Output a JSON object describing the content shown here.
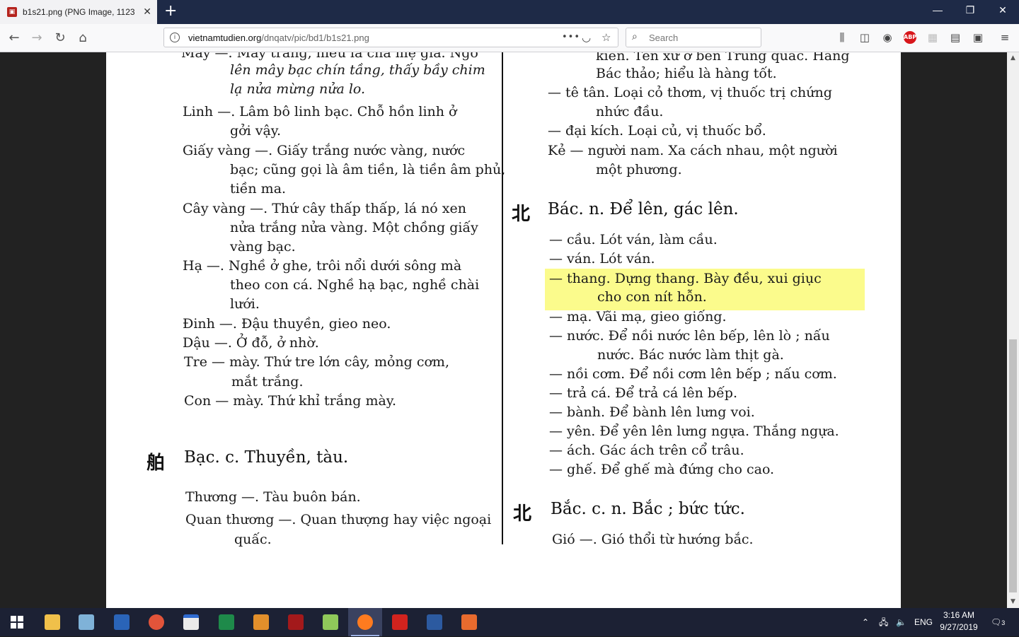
{
  "browser": {
    "tab_title": "b1s21.png (PNG Image, 1123 ×",
    "tab_close": "✕",
    "new_tab": "+",
    "window_controls": {
      "minimize": "—",
      "restore": "❐",
      "close": "✕"
    },
    "url_domain": "vietnamtudien.org",
    "url_path": "/dnqatv/pic/bd1/b1s21.png",
    "page_actions": "•••",
    "search_placeholder": "Search",
    "icons": [
      "back-icon",
      "forward-icon",
      "reload-icon",
      "home-icon",
      "info-icon",
      "pocket-icon",
      "bookmark-star-icon",
      "search-icon",
      "library-icon",
      "sidebar-icon",
      "account-icon",
      "adblock-icon",
      "extension-icon",
      "reader-icon",
      "screenshot-icon",
      "menu-icon"
    ],
    "abp_label": "ABP"
  },
  "document": {
    "left_column": {
      "top_partial_1": "Mây —. Mây trắng, hiểu là cha mẹ già. Ngó",
      "top_partial_2": "lên mây bạc chín tầng, thấy bầy chim",
      "top_partial_3": "lạ nửa mừng nửa lo.",
      "linh_1": "Linh —. Lâm bô linh bạc. Chỗ hồn linh ở",
      "linh_2": "gởi vậy.",
      "giay_1": "Giấy vàng —. Giấy trắng nước vàng, nước",
      "giay_2": "bạc; cũng gọi là âm tiền, là tiền âm phủ,",
      "giay_3": "tiền ma.",
      "cay_1": "Cây vàng —. Thứ cây thấp thấp, lá nó xen",
      "cay_2": "nửa trắng nửa vàng. Một chồng giấy",
      "cay_3": "vàng bạc.",
      "ha_1": "Hạ —. Nghề ở ghe, trôi nổi dưới sông mà",
      "ha_2": "theo con cá. Nghề hạ bạc, nghề chài",
      "ha_3": "lưới.",
      "dinh": "Đinh —. Đậu thuyền, gieo neo.",
      "dau": "Dậu —. Ở đỗ, ở nhờ.",
      "tre_1": "Tre — mày. Thứ tre lớn cây, mỏng cơm,",
      "tre_2": "mắt trắng.",
      "con": "Con — mày. Thứ khỉ trắng mày.",
      "entry2_hanzi": "舶",
      "entry2_head": "Bạc. c. Thuyền, tàu.",
      "thuong": "Thương —. Tàu buôn bán.",
      "quan_1": "Quan thương —. Quan thượng hay việc ngoại",
      "quan_2": "quấc."
    },
    "right_column": {
      "top_1": "kiển. Tên xứ ở bên Trung quấc. Hàng",
      "top_2": "Bác thảo; hiểu là hàng tốt.",
      "te_tan_1": "— tê tân. Loại cỏ thơm, vị thuốc trị chứng",
      "te_tan_2": "nhức đầu.",
      "dai_kich": "— đại kích. Loại củ, vị thuốc bổ.",
      "ke_1": "Kẻ — người nam. Xa cách nhau, một người",
      "ke_2": "một phương.",
      "entry1_hanzi": "北",
      "entry1_head": "Bác. n. Để lên, gác lên.",
      "cau": "— cầu. Lót ván, làm cầu.",
      "van": "— ván. Lót ván.",
      "thang_1": "— thang. Dựng thang. Bày đều, xui giục",
      "thang_2": "cho con nít hỗn.",
      "ma": "— mạ. Vãi mạ, gieo giống.",
      "nuoc_1": "— nước. Để nồi nước lên bếp, lên lò ; nấu",
      "nuoc_2": "nước. Bác nước làm thịt gà.",
      "noi_com": "— nồi cơm. Để nồi cơm lên bếp ; nấu cơm.",
      "tra_ca": "— trả cá. Để trả cá lên bếp.",
      "banh": "— bành. Để bành lên lưng voi.",
      "yen": "— yên. Để yên lên lưng ngựa. Thắng ngựa.",
      "ach": "— ách. Gác ách trên cổ trâu.",
      "ghe": "— ghế. Để ghế mà đứng cho cao.",
      "entry3_hanzi": "北",
      "entry3_head": "Bắc. c. n. Bắc ; bức tức.",
      "gio": "Gió —. Gió thổi từ hướng bắc."
    }
  },
  "taskbar": {
    "apps": [
      "start-icon",
      "file-explorer-icon",
      "notepad-icon",
      "powershell-icon",
      "chrome-icon",
      "window-icon",
      "pycharm-icon",
      "sublime-icon",
      "acrobat-icon",
      "notepadpp-icon",
      "firefox-icon",
      "pdf-reader-icon",
      "word-icon",
      "slides-icon"
    ],
    "language": "ENG",
    "time": "3:16 AM",
    "date": "9/27/2019",
    "notification_count": "3"
  }
}
